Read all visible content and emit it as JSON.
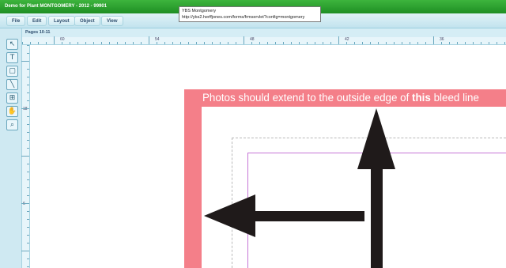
{
  "window": {
    "title": "Demo for Plant MONTGOMERY - 2012 - 99901"
  },
  "menu": [
    "File",
    "Edit",
    "Layout",
    "Object",
    "View"
  ],
  "tooltip": {
    "line1": "YBS Montgomery",
    "line2": "http://ybs2.herffjones.com/forms/frmservlet?config=montgomery"
  },
  "tools": [
    {
      "name": "select-tool",
      "icon": "cursor-icon",
      "glyph": "↖"
    },
    {
      "name": "text-tool",
      "icon": "text-icon",
      "glyph": "T"
    },
    {
      "name": "frame-tool",
      "icon": "rectangle-icon",
      "glyph": "▢"
    },
    {
      "name": "line-tool",
      "icon": "line-icon",
      "glyph": "╲"
    },
    {
      "name": "image-tool",
      "icon": "image-frame-icon",
      "glyph": "⊞"
    },
    {
      "name": "hand-tool",
      "icon": "hand-icon",
      "glyph": "✋"
    },
    {
      "name": "zoom-tool",
      "icon": "magnifier-icon",
      "glyph": "⌕"
    }
  ],
  "pages_label": "Pages 10-11",
  "ruler": {
    "h_labels": [
      "60",
      "54",
      "48",
      "42",
      "36"
    ],
    "v_labels": [
      "18",
      "6"
    ]
  },
  "canvas": {
    "instruction_before": "Photos should extend to the outside edge of ",
    "instruction_bold": "this",
    "instruction_after": " bleed line",
    "bleed_color": "#f47f89"
  }
}
